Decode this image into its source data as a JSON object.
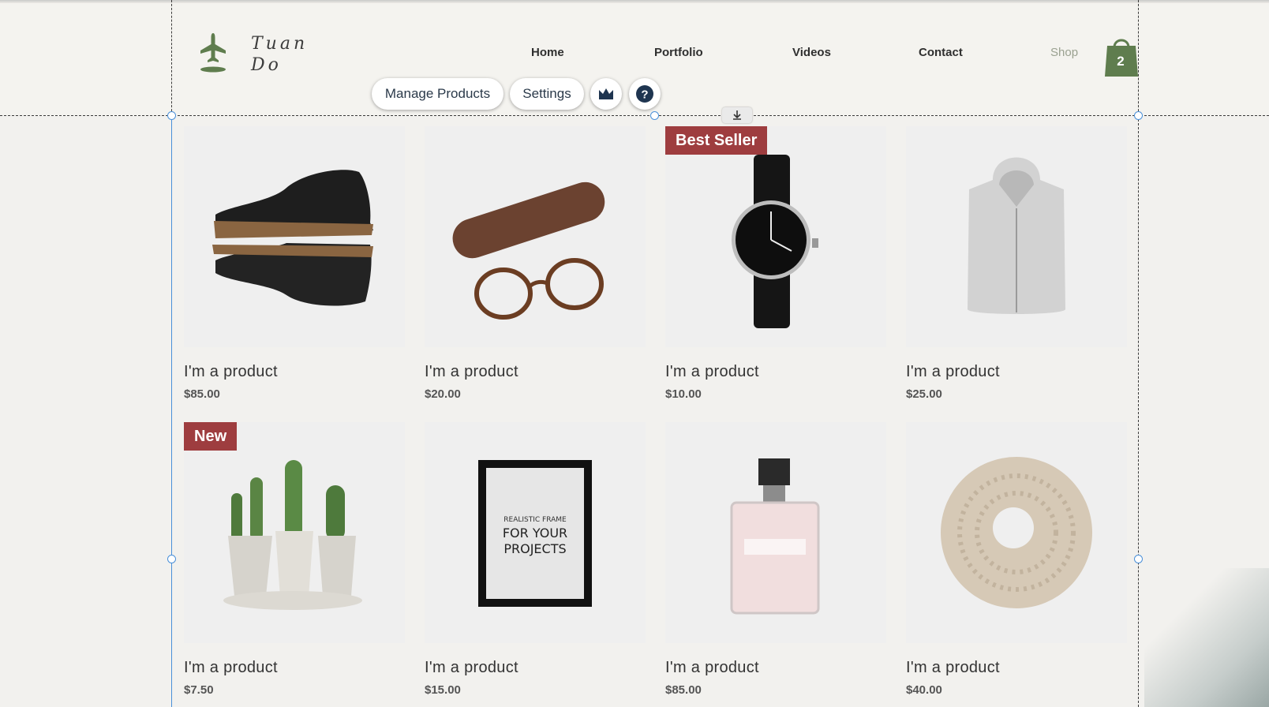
{
  "site": {
    "logo_line1": "Tuan",
    "logo_line2": "Do",
    "nav": [
      {
        "label": "Home"
      },
      {
        "label": "Portfolio"
      },
      {
        "label": "Videos"
      },
      {
        "label": "Contact"
      },
      {
        "label": "Shop"
      }
    ],
    "cart_count": "2"
  },
  "editor": {
    "manage_products_label": "Manage Products",
    "settings_label": "Settings",
    "crown_icon": "crown-icon",
    "help_icon": "help-icon",
    "anchor_icon": "download-anchor-icon"
  },
  "products": [
    {
      "name": "I'm a product",
      "price": "$85.00",
      "ribbon": "",
      "image": "chukka-boots"
    },
    {
      "name": "I'm a product",
      "price": "$20.00",
      "ribbon": "",
      "image": "glasses-and-case"
    },
    {
      "name": "I'm a product",
      "price": "$10.00",
      "ribbon": "Best Seller",
      "image": "wrist-watch"
    },
    {
      "name": "I'm a product",
      "price": "$25.00",
      "ribbon": "",
      "image": "grey-hoodie"
    },
    {
      "name": "I'm a product",
      "price": "$7.50",
      "ribbon": "New",
      "image": "cactus-pots"
    },
    {
      "name": "I'm a product",
      "price": "$15.00",
      "ribbon": "",
      "image": "picture-frame",
      "frame_text_small": "REALISTIC FRAME",
      "frame_text_large1": "FOR YOUR",
      "frame_text_large2": "PROJECTS"
    },
    {
      "name": "I'm a product",
      "price": "$85.00",
      "ribbon": "",
      "image": "perfume-bottle"
    },
    {
      "name": "I'm a product",
      "price": "$40.00",
      "ribbon": "",
      "image": "knit-scarf"
    }
  ],
  "colors": {
    "brand_green": "#5f7d4e",
    "ribbon_red": "#9e3d3f",
    "selection_blue": "#4a90d9"
  }
}
